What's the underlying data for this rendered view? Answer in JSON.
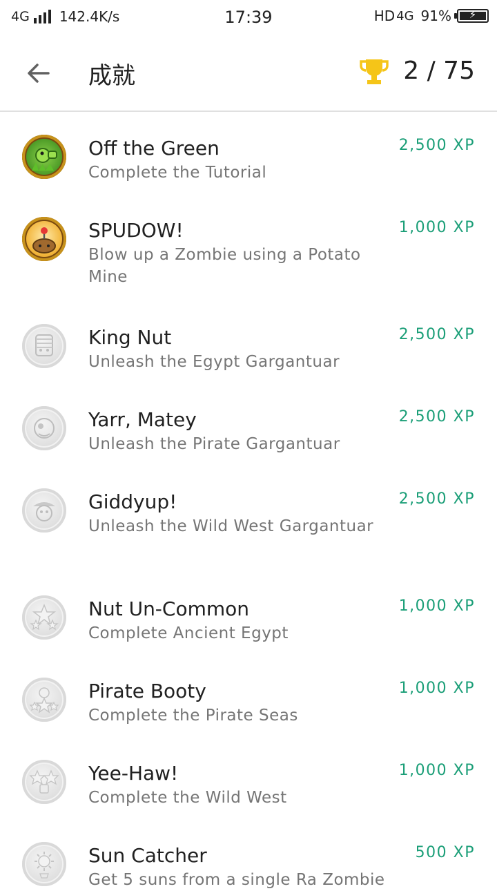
{
  "status_bar": {
    "network": "4G",
    "speed": "142.4K/s",
    "time": "17:39",
    "hd_label": "HD",
    "mobile_label": "4G",
    "battery": "91%"
  },
  "header": {
    "title": "成就",
    "progress": "2 / 75"
  },
  "achievements": [
    {
      "name": "Off the Green",
      "description": "Complete the Tutorial",
      "xp": "2,500 XP",
      "icon": "peashooter-badge",
      "unlocked": true
    },
    {
      "name": "SPUDOW!",
      "description": "Blow up a Zombie using a Potato Mine",
      "xp": "1,000 XP",
      "icon": "potato-mine-badge",
      "unlocked": true
    },
    {
      "name": "King Nut",
      "description": "Unleash the Egypt Gargantuar",
      "xp": "2,500 XP",
      "icon": "egypt-gargantuar-badge",
      "unlocked": false
    },
    {
      "name": "Yarr, Matey",
      "description": "Unleash the Pirate Gargantuar",
      "xp": "2,500 XP",
      "icon": "pirate-gargantuar-badge",
      "unlocked": false
    },
    {
      "name": "Giddyup!",
      "description": "Unleash the Wild West Gargantuar",
      "xp": "2,500 XP",
      "icon": "wild-west-gargantuar-badge",
      "unlocked": false
    },
    {
      "name": "Nut Un-Common",
      "description": "Complete Ancient Egypt",
      "xp": "1,000 XP",
      "icon": "stars-badge",
      "unlocked": false
    },
    {
      "name": "Pirate Booty",
      "description": "Complete the Pirate Seas",
      "xp": "1,000 XP",
      "icon": "stars-skull-badge",
      "unlocked": false
    },
    {
      "name": "Yee-Haw!",
      "description": "Complete the Wild West",
      "xp": "1,000 XP",
      "icon": "stars-barrel-badge",
      "unlocked": false
    },
    {
      "name": "Sun Catcher",
      "description": "Get 5 suns from a single Ra Zombie",
      "xp": "500 XP",
      "icon": "sun-badge",
      "unlocked": false
    }
  ]
}
